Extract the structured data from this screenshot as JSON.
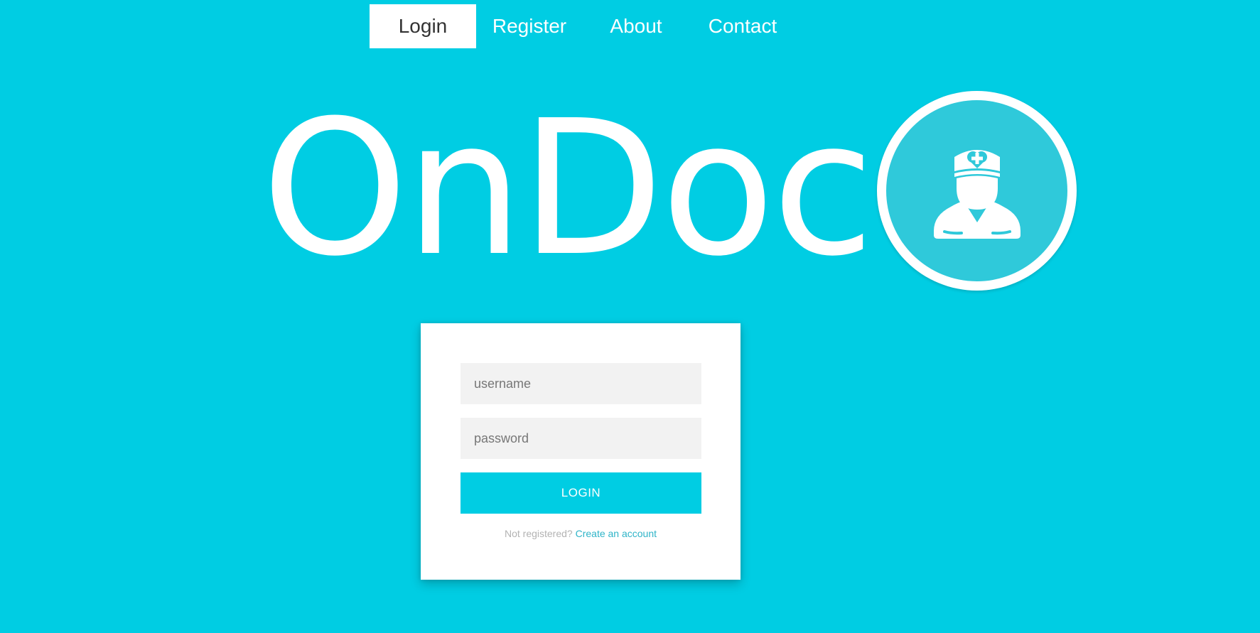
{
  "nav": {
    "items": [
      {
        "label": "Login",
        "active": true
      },
      {
        "label": "Register",
        "active": false
      },
      {
        "label": "About",
        "active": false
      },
      {
        "label": "Contact",
        "active": false
      }
    ]
  },
  "brand": {
    "name": "OnDoc",
    "logo_icon": "nurse-icon"
  },
  "login_form": {
    "username_placeholder": "username",
    "username_value": "",
    "password_placeholder": "password",
    "password_value": "",
    "submit_label": "LOGIN",
    "register_prompt": "Not registered?",
    "register_link": "Create an account"
  },
  "colors": {
    "background": "#00CDE3",
    "logo_inner": "#2FC9DA",
    "link": "#2FB4C8",
    "card": "#ffffff"
  }
}
